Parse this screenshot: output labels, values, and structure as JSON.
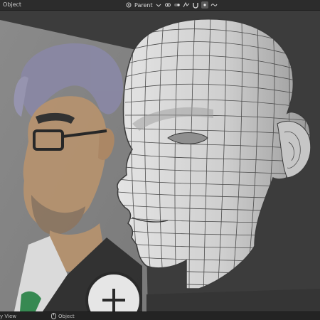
{
  "header": {
    "mode_label": "Object",
    "pivot_label": "Parent",
    "icons": [
      "pivot-icon",
      "chevron-down-icon",
      "link-icon",
      "toggle-icon",
      "snap-icon",
      "magnet-icon",
      "dot-icon",
      "wave-icon"
    ]
  },
  "status": {
    "left_label": "y View",
    "object_label": "Object"
  },
  "colors": {
    "header_bg": "#2c2c2c",
    "viewport_bg": "#3c3c3c",
    "reference_card": "#8c8c8c",
    "mesh_fill": "#cfcfcf",
    "wire": "#4a4a4a"
  }
}
